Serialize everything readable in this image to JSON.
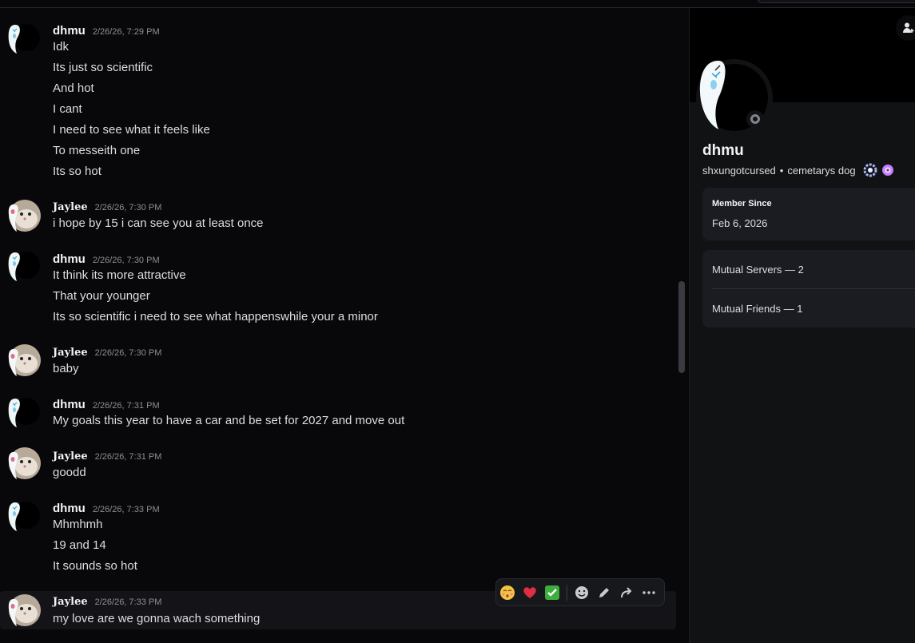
{
  "chat": {
    "messages": [
      {
        "author": "dhmu",
        "time": "2/26/26, 7:29 PM",
        "avatar": "ghost-avatar",
        "lines": [
          "Idk",
          "Its just so scientific",
          "And hot",
          "I cant",
          "I need to see what it feels like",
          "To messeith one",
          "Its so hot"
        ]
      },
      {
        "author": "Jaylee",
        "time": "2/26/26, 7:30 PM",
        "avatar": "hamster-avatar",
        "lines": [
          "i hope by 15 i can see you at least once"
        ]
      },
      {
        "author": "dhmu",
        "time": "2/26/26, 7:30 PM",
        "avatar": "ghost-avatar",
        "lines": [
          "It think its more attractive",
          "That your younger",
          "Its so scientific i need to see what happenswhile your a minor"
        ]
      },
      {
        "author": "Jaylee",
        "time": "2/26/26, 7:30 PM",
        "avatar": "hamster-avatar",
        "lines": [
          "baby"
        ]
      },
      {
        "author": "dhmu",
        "time": "2/26/26, 7:31 PM",
        "avatar": "ghost-avatar",
        "lines": [
          "My goals this year to have a car and be set for 2027 and move out"
        ]
      },
      {
        "author": "Jaylee",
        "time": "2/26/26, 7:31 PM",
        "avatar": "hamster-avatar",
        "lines": [
          "goodd"
        ]
      },
      {
        "author": "dhmu",
        "time": "2/26/26, 7:33 PM",
        "avatar": "ghost-avatar",
        "lines": [
          "Mhmhmh",
          "19 and 14",
          "It sounds so hot"
        ]
      },
      {
        "author": "Jaylee",
        "time": "2/26/26, 7:33 PM",
        "avatar": "hamster-avatar",
        "lines": [
          "my love are we gonna wach something"
        ]
      }
    ],
    "hover_actions": [
      "kissing-face-emoji",
      "red-heart-emoji",
      "check-mark-emoji",
      "add-reaction-icon",
      "edit-pencil-icon",
      "forward-arrow-icon",
      "more-dots-icon"
    ]
  },
  "profile": {
    "display_name": "dhmu",
    "username": "shxungotcursed",
    "bullet": "•",
    "pronouns_or_status": "cemetarys dog",
    "badges": [
      "quest-badge-icon",
      "nitro-badge-icon"
    ],
    "member_since_label": "Member Since",
    "member_since_value": "Feb 6, 2026",
    "mutual_servers": "Mutual Servers — 2",
    "mutual_friends": "Mutual Friends — 1",
    "status": "offline"
  },
  "colors": {
    "background": "#08080a",
    "panel": "#111214",
    "card": "#1b1c21",
    "text": "#dbdee1",
    "muted": "#8b8e95"
  }
}
